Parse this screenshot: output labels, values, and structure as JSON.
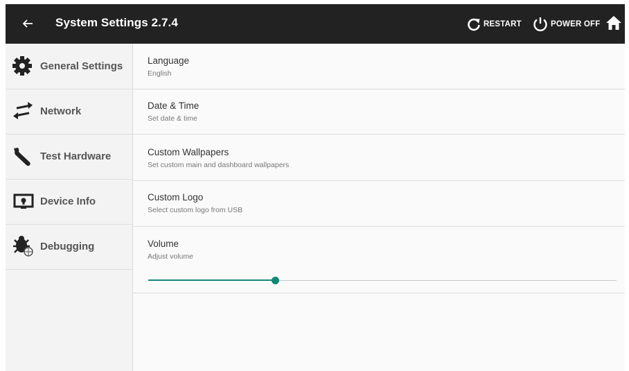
{
  "header": {
    "back_icon": "arrow-left-icon",
    "title": "System Settings 2.7.4",
    "restart_label": "RESTART",
    "power_off_label": "POWER OFF",
    "home_icon": "home-icon"
  },
  "sidebar": {
    "items": [
      {
        "label": "General Settings",
        "icon": "gear-icon"
      },
      {
        "label": "Network",
        "icon": "swap-arrows-icon"
      },
      {
        "label": "Test Hardware",
        "icon": "wrench-icon"
      },
      {
        "label": "Device Info",
        "icon": "monitor-icon"
      },
      {
        "label": "Debugging",
        "icon": "bug-icon"
      }
    ]
  },
  "settings": {
    "items": [
      {
        "title": "Language",
        "subtitle": "English"
      },
      {
        "title": "Date & Time",
        "subtitle": "Set date & time"
      },
      {
        "title": "Custom Wallpapers",
        "subtitle": "Set custom main and dashboard wallpapers"
      },
      {
        "title": "Custom Logo",
        "subtitle": "Select custom logo from USB"
      },
      {
        "title": "Volume",
        "subtitle": "Adjust volume"
      }
    ],
    "volume_level": 0.27
  },
  "colors": {
    "topbar": "#222222",
    "accent": "#118878"
  }
}
